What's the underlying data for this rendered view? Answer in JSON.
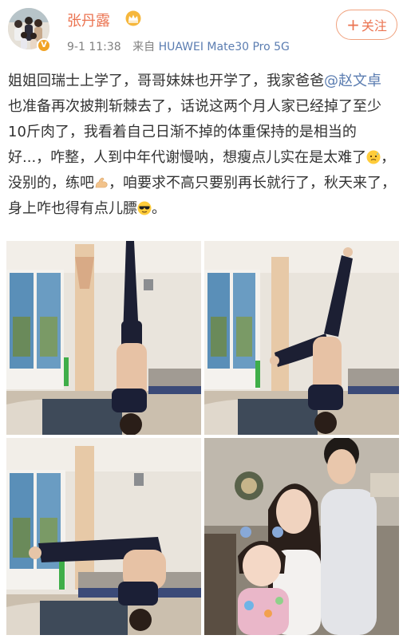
{
  "post": {
    "author": {
      "name": "张丹露",
      "avatar_icon": "family-avatar",
      "badge_icon": "verified-v-badge",
      "crown_icon": "crown-icon"
    },
    "meta": {
      "time": "9-1 11:38",
      "source_prefix": "来自",
      "device": "HUAWEI Mate30 Pro 5G"
    },
    "follow_label": "关注",
    "follow_plus": "+",
    "text": {
      "part1": "姐姐回瑞士上学了，哥哥妹妹也开学了，我家爸爸",
      "mention": "@赵文卓",
      "part2": " 也准备再次披荆斩棘去了，话说这两个月人家已经掉了至少10斤肉了，我看着自己日渐不掉的体重保持的是相当的好...，咋整，人到中年代谢慢呐，想瘦点儿实在是太难了",
      "part3": "，没别的，练吧",
      "part4": "，咱要求不高只要别再长就行了，秋天来了，身上咋也得有点儿膘",
      "part5": "。",
      "emoji_1": "cold-sweat-emoji",
      "emoji_2": "flexed-biceps-emoji",
      "emoji_3": "sunglasses-emoji"
    },
    "photos": [
      {
        "id": "photo-1",
        "subject": "headstand-straight"
      },
      {
        "id": "photo-2",
        "subject": "headstand-split"
      },
      {
        "id": "photo-3",
        "subject": "yoga-pose"
      },
      {
        "id": "photo-4",
        "subject": "children-portrait"
      }
    ]
  },
  "colors": {
    "name": "#eb7350",
    "link": "#5b7db1",
    "meta": "#808080",
    "follow_border": "#f0a27f",
    "vip": "#f1a325"
  }
}
